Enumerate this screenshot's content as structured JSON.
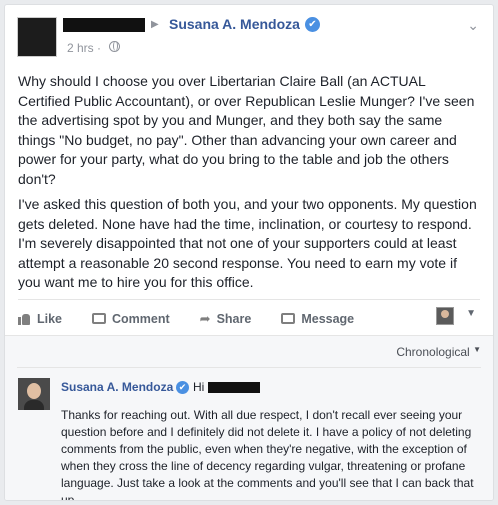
{
  "post": {
    "page_name": "Susana A. Mendoza",
    "verified_mark": "✔",
    "timestamp": "2 hrs ·",
    "body": [
      "Why should I choose you over Libertarian Claire Ball (an ACTUAL Certified Public Accountant), or over Republican Leslie Munger? I've seen the advertising spot by you and Munger, and they both say the same things \"No budget, no pay\". Other than advancing your own career and power for your party, what do you bring to the table and job the others don't?",
      "I've asked this question of both you, and your two opponents. My question gets deleted. None have had the time, inclination, or courtesy to respond. I'm severely disappointed that not one of your supporters could at least attempt a reasonable 20 second response. You need to earn my vote if you want me to hire you for this office."
    ]
  },
  "actions": {
    "like": "Like",
    "comment": "Comment",
    "share": "Share",
    "message": "Message"
  },
  "comments": {
    "order_label": "Chronological",
    "items": [
      {
        "author": "Susana A. Mendoza",
        "verified_mark": "✔",
        "greeting": "Hi",
        "text": "Thanks for reaching out. With all due respect, I don't recall ever seeing your question before and I definitely did not delete it. I have a policy of not deleting comments from the public, even when they're negative, with the exception of when they cross the line of decency regarding vulgar, threatening or profane language. Just take a look at the comments and you'll see that I can back that up."
      }
    ]
  },
  "icons": [
    "globe-icon",
    "chevron-down-icon",
    "like-icon",
    "comment-icon",
    "share-icon",
    "message-icon",
    "verified-icon"
  ],
  "colors": {
    "link": "#365899",
    "verified": "#4a90e2",
    "muted": "#90949c"
  }
}
